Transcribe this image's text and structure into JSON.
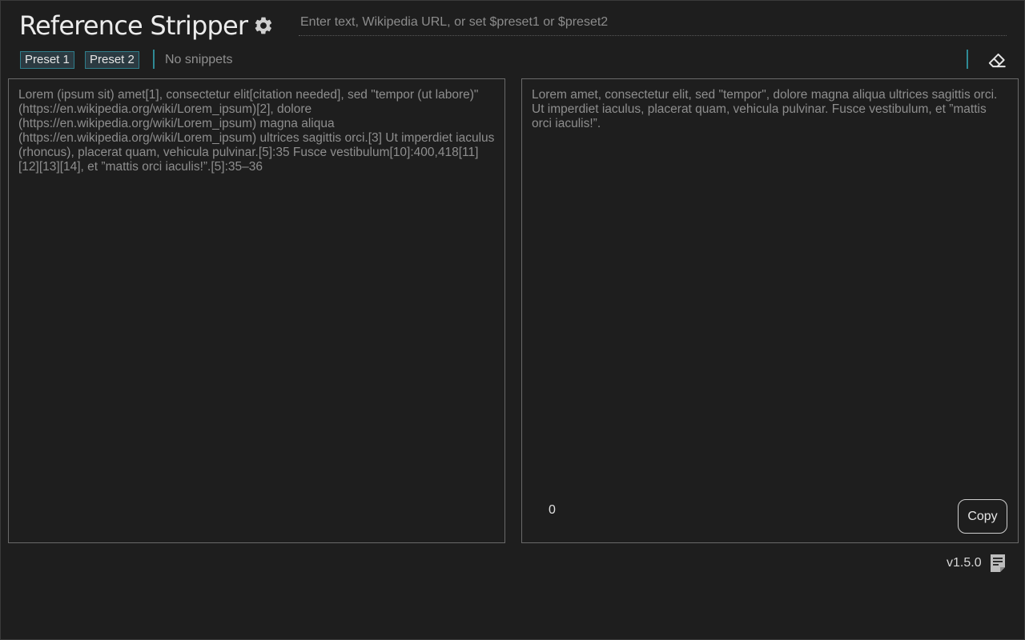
{
  "header": {
    "title": "Reference Stripper",
    "settings_icon": "gear-icon",
    "search_placeholder": "Enter text, Wikipedia URL, or set $preset1 or $preset2",
    "search_value": ""
  },
  "toolbar": {
    "preset1_label": "Preset 1",
    "preset2_label": "Preset 2",
    "snippets_status": "No snippets",
    "clear_icon": "eraser-icon"
  },
  "input_panel": {
    "text": "Lorem (ipsum sit) amet[1], consectetur elit[citation needed], sed \"tempor (ut labore)\" (https://en.wikipedia.org/wiki/Lorem_ipsum)[2], dolore (https://en.wikipedia.org/wiki/Lorem_ipsum) magna aliqua (https://en.wikipedia.org/wiki/Lorem_ipsum) ultrices sagittis orci.[3] Ut imperdiet iaculus (rhoncus), placerat quam, vehicula pulvinar.[5]:35 Fusce vestibulum[10]:400,418[11][12][13][14], et ”mattis orci iaculis!”.[5]:35–36"
  },
  "output_panel": {
    "text": "Lorem amet, consectetur elit, sed \"tempor\", dolore magna aliqua ultrices sagittis orci. Ut imperdiet iaculus, placerat quam, vehicula pulvinar. Fusce vestibulum, et ”mattis orci iaculis!”.",
    "count": "0",
    "copy_label": "Copy"
  },
  "footer": {
    "version": "v1.5.0",
    "notes_icon": "notes-icon"
  },
  "colors": {
    "background": "#1e1e1e",
    "accent": "#2f8a95",
    "panel_border": "#6a6a6a",
    "muted_text": "#8e8e8e"
  }
}
